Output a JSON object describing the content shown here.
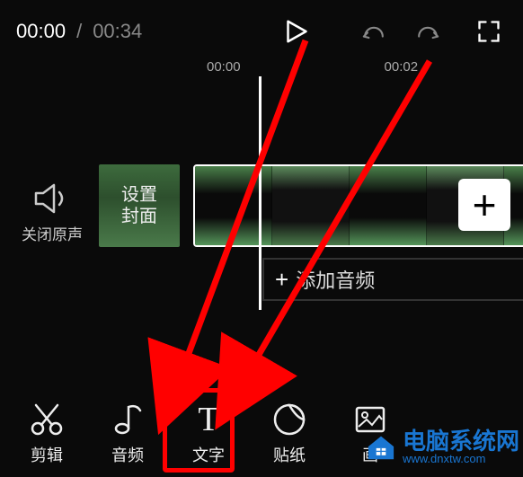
{
  "time": {
    "current": "00:00",
    "separator": "/",
    "duration": "00:34"
  },
  "ruler": {
    "t0": "00:00",
    "t1": "00:02"
  },
  "mute": {
    "label": "关闭原声"
  },
  "cover": {
    "label_line1": "设置",
    "label_line2": "封面"
  },
  "add_button": {
    "glyph": "+"
  },
  "add_audio": {
    "plus": "+",
    "label": "添加音频"
  },
  "toolbar": {
    "edit": "剪辑",
    "audio": "音频",
    "text": "文字",
    "sticker": "贴纸",
    "pip": "画"
  },
  "watermark": {
    "brand": "电脑系统网",
    "url": "www.dnxtw.com"
  }
}
